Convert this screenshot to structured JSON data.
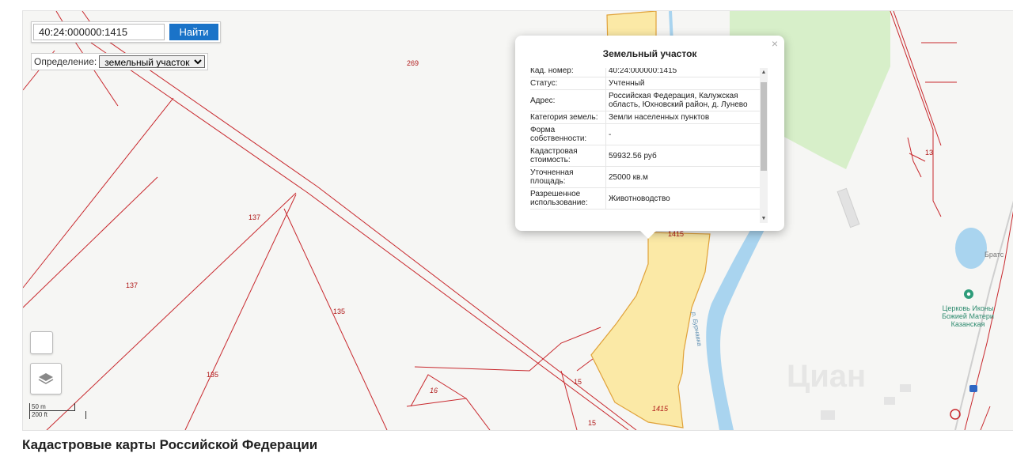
{
  "search": {
    "value": "40:24:000000:1415",
    "button_label": "Найти"
  },
  "definition": {
    "label": "Определение:",
    "selected": "земельный участок"
  },
  "popup": {
    "title": "Земельный участок",
    "close_label": "×",
    "rows": [
      {
        "key": "Кад. номер:",
        "value": "40:24:000000:1415"
      },
      {
        "key": "Статус:",
        "value": "Учтенный"
      },
      {
        "key": "Адрес:",
        "value": "Российская Федерация, Калужская область, Юхновский район, д. Лунево"
      },
      {
        "key": "Категория земель:",
        "value": "Земли населенных пунктов"
      },
      {
        "key": "Форма собственности:",
        "value": "-"
      },
      {
        "key": "Кадастровая стоимость:",
        "value": "59932.56 руб"
      },
      {
        "key": "Уточненная площадь:",
        "value": "25000 кв.м"
      },
      {
        "key": "Разрешенное использование:",
        "value": "Животноводство"
      }
    ]
  },
  "map": {
    "parcel_labels": [
      "269",
      "137",
      "137",
      "135",
      "135",
      "16",
      "15",
      "15",
      "1415",
      "1415",
      "13"
    ],
    "river_label": "р. Бурнавка",
    "poi_name": "Церковь Иконы Божией Матери Казанская",
    "place_label": "Братс",
    "watermark": "Циан",
    "colors": {
      "boundary": "#c8282d",
      "parcel_fill": "#fbe9a6",
      "parcel_stroke": "#e0a23a",
      "water": "#a9d4ef",
      "green": "#d7efc9",
      "background": "#f6f6f4"
    }
  },
  "scale": {
    "metric": "50 m",
    "imperial": "200 ft"
  },
  "caption": "Кадастровые карты Российской Федерации"
}
